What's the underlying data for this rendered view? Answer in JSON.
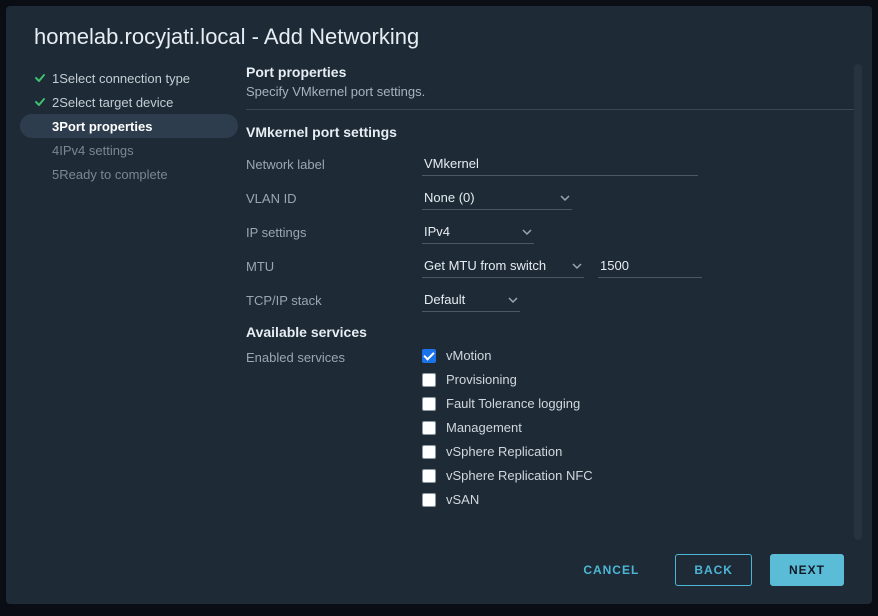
{
  "title": "homelab.rocyjati.local - Add Networking",
  "wizard": {
    "steps": [
      {
        "num": "1",
        "label": "Select connection type",
        "state": "done"
      },
      {
        "num": "2",
        "label": "Select target device",
        "state": "done"
      },
      {
        "num": "3",
        "label": "Port properties",
        "state": "active"
      },
      {
        "num": "4",
        "label": "IPv4 settings",
        "state": "future"
      },
      {
        "num": "5",
        "label": "Ready to complete",
        "state": "future"
      }
    ]
  },
  "page": {
    "heading": "Port properties",
    "sub": "Specify VMkernel port settings.",
    "settings_heading": "VMkernel port settings",
    "network_label": {
      "label": "Network label",
      "value": "VMkernel"
    },
    "vlan": {
      "label": "VLAN ID",
      "value": "None (0)"
    },
    "ip_settings": {
      "label": "IP settings",
      "value": "IPv4"
    },
    "mtu": {
      "label": "MTU",
      "mode": "Get MTU from switch",
      "value": "1500"
    },
    "tcpip": {
      "label": "TCP/IP stack",
      "value": "Default"
    },
    "available_heading": "Available services",
    "enabled_label": "Enabled services",
    "services": [
      {
        "label": "vMotion",
        "checked": true
      },
      {
        "label": "Provisioning",
        "checked": false
      },
      {
        "label": "Fault Tolerance logging",
        "checked": false
      },
      {
        "label": "Management",
        "checked": false
      },
      {
        "label": "vSphere Replication",
        "checked": false
      },
      {
        "label": "vSphere Replication NFC",
        "checked": false
      },
      {
        "label": "vSAN",
        "checked": false
      }
    ]
  },
  "footer": {
    "cancel": "CANCEL",
    "back": "BACK",
    "next": "NEXT"
  }
}
